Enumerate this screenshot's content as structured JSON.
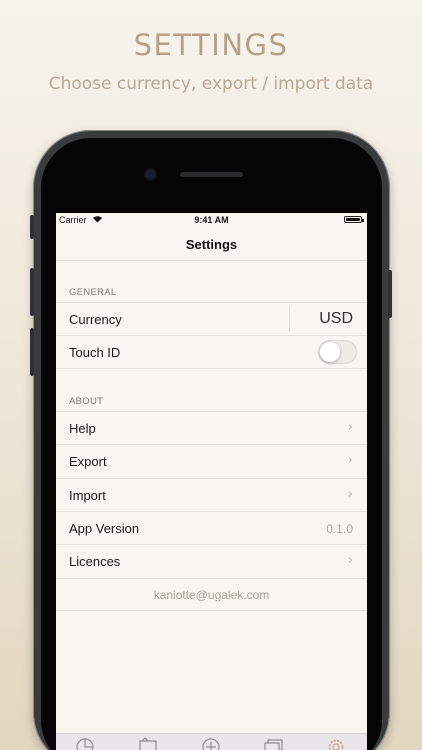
{
  "promo": {
    "headline": "SETTINGS",
    "subline": "Choose currency, export / import data"
  },
  "status_bar": {
    "carrier": "Carrier",
    "time": "9:41 AM"
  },
  "nav": {
    "title": "Settings"
  },
  "general": {
    "header": "GENERAL",
    "currency_label": "Currency",
    "currency_value": "USD",
    "touch_id_label": "Touch ID",
    "touch_id_enabled": false
  },
  "about": {
    "header": "ABOUT",
    "help_label": "Help",
    "export_label": "Export",
    "import_label": "Import",
    "app_version_label": "App Version",
    "app_version_value": "0.1.0",
    "licences_label": "Licences"
  },
  "footer": {
    "email": "kaniotte@ugalek.com"
  },
  "tabbar": {
    "tabs": [
      "chart-icon",
      "wallet-icon",
      "add-icon",
      "cards-icon",
      "settings-gear-icon"
    ],
    "active_tab": "settings-gear-icon",
    "active_color": "#c9a27a",
    "inactive_color": "#8e8c92"
  },
  "colors": {
    "promo_text": "#b5a18a",
    "screen_bg": "#f8f6f1"
  }
}
